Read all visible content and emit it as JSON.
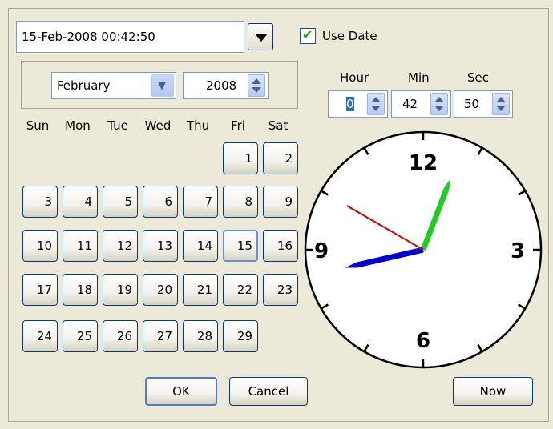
{
  "date_field": {
    "value": "15-Feb-2008 00:42:50"
  },
  "use_date": {
    "label": "Use Date",
    "checked": true
  },
  "month_select": {
    "value": "February"
  },
  "year_spinner": {
    "value": "2008"
  },
  "weekdays": [
    "Sun",
    "Mon",
    "Tue",
    "Wed",
    "Thu",
    "Fri",
    "Sat"
  ],
  "days": [
    "1",
    "2",
    "3",
    "4",
    "5",
    "6",
    "7",
    "8",
    "9",
    "10",
    "11",
    "12",
    "13",
    "14",
    "15",
    "16",
    "17",
    "18",
    "19",
    "20",
    "21",
    "22",
    "23",
    "24",
    "25",
    "26",
    "27",
    "28",
    "29"
  ],
  "selected_day": "15",
  "time": {
    "hour_label": "Hour",
    "min_label": "Min",
    "sec_label": "Sec",
    "hour": "0",
    "min": "42",
    "sec": "50"
  },
  "clock": {
    "numerals": {
      "n12": "12",
      "n3": "3",
      "n6": "6",
      "n9": "9"
    },
    "hour_hand_color": "#22cc22",
    "minute_hand_color": "#0000cc",
    "second_hand_color": "#cc0000"
  },
  "buttons": {
    "ok": "OK",
    "cancel": "Cancel",
    "now": "Now"
  }
}
